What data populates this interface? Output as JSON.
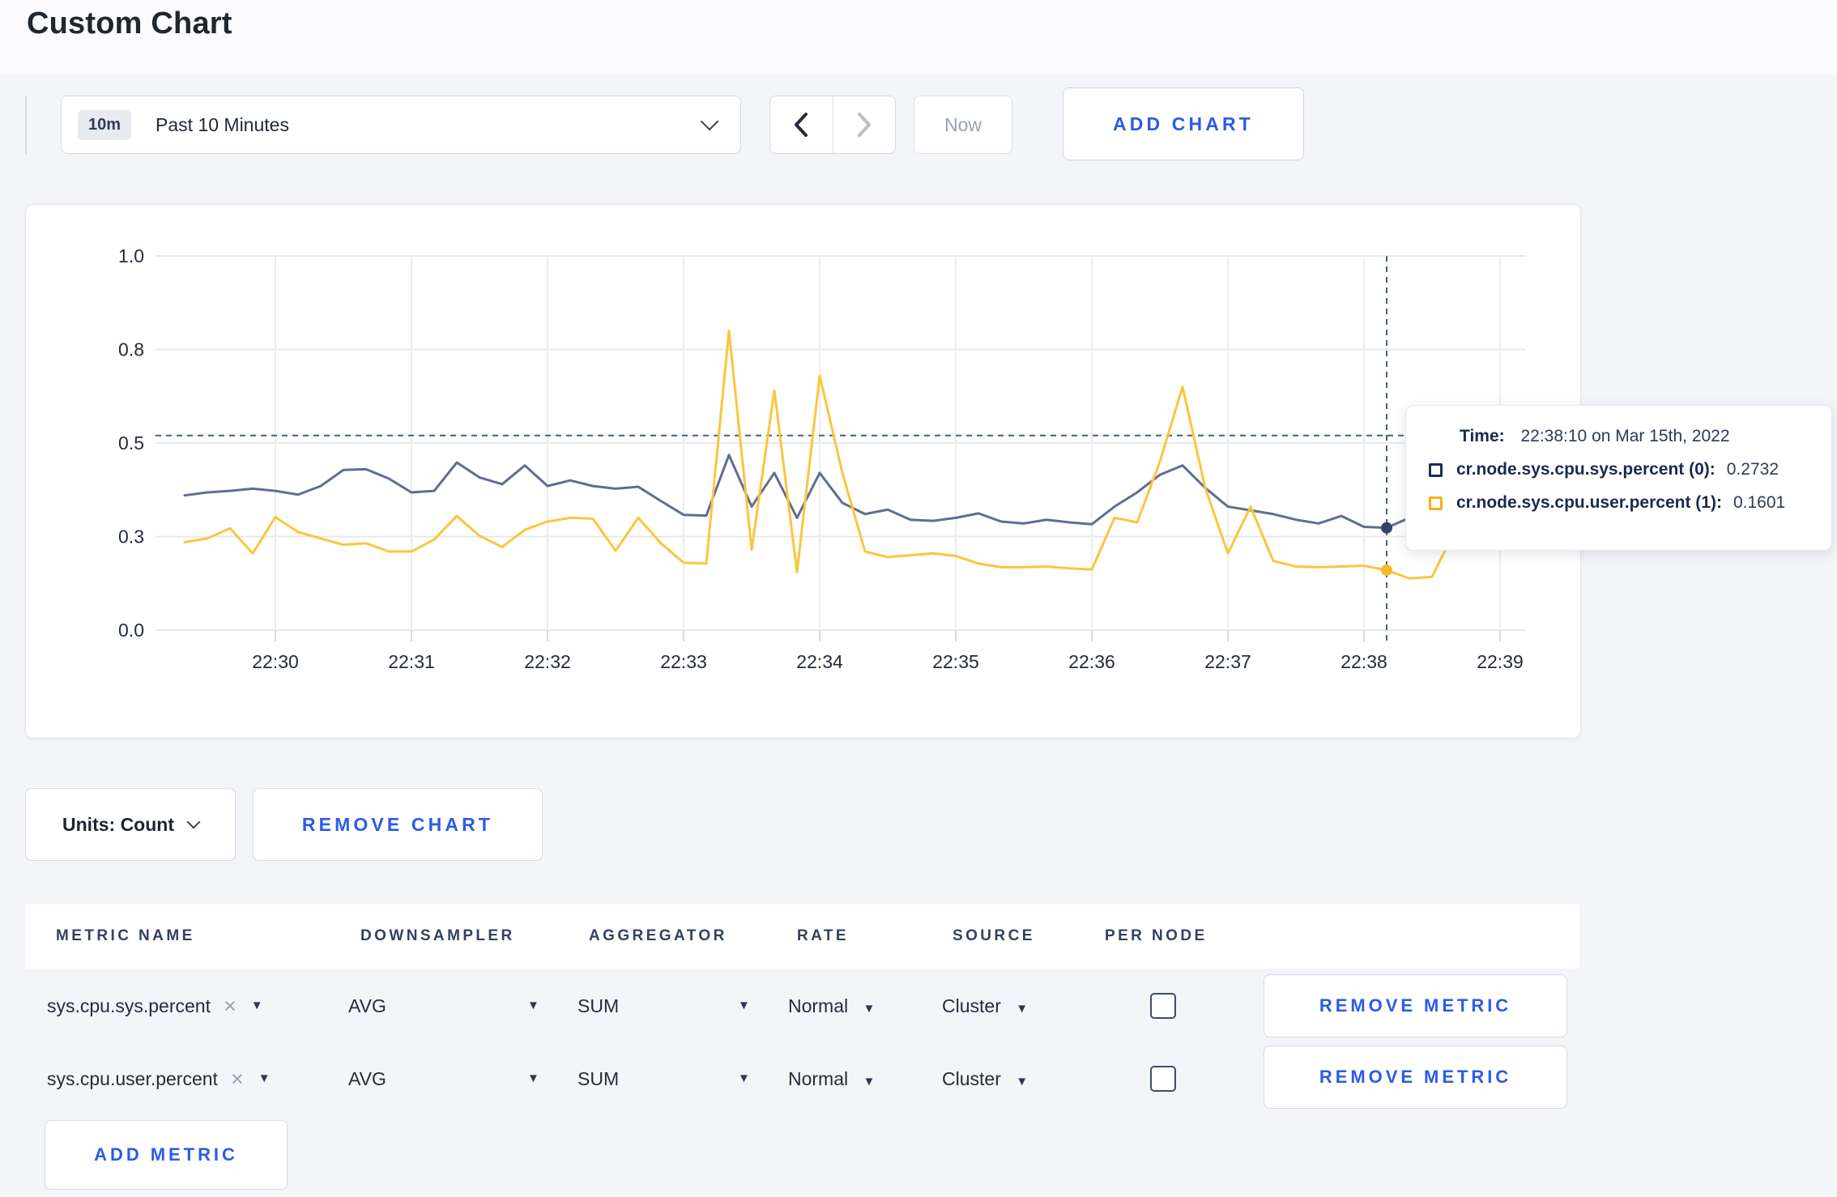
{
  "page": {
    "title": "Custom Chart"
  },
  "icons": {
    "caret_down": "▼",
    "close": "×"
  },
  "toolbar": {
    "range_badge": "10m",
    "range_label": "Past 10 Minutes",
    "now_label": "Now",
    "add_chart_label": "ADD CHART"
  },
  "chart_data": {
    "type": "line",
    "title": "",
    "xlabel": "",
    "ylabel": "",
    "ylim": [
      0,
      1.0
    ],
    "grid": true,
    "x_axis": {
      "labels": [
        "22:30",
        "22:31",
        "22:32",
        "22:33",
        "22:34",
        "22:35",
        "22:36",
        "22:37",
        "22:38",
        "22:39"
      ]
    },
    "y_axis": {
      "ticks": [
        {
          "label": "1.0",
          "value": 1.0
        },
        {
          "label": "0.8",
          "value": 0.75
        },
        {
          "label": "0.5",
          "value": 0.5
        },
        {
          "label": "0.3",
          "value": 0.25
        },
        {
          "label": "0.0",
          "value": 0.0
        }
      ]
    },
    "x_seconds": [
      -40,
      -30,
      -20,
      -10,
      0,
      10,
      20,
      30,
      40,
      50,
      60,
      70,
      80,
      90,
      100,
      110,
      120,
      130,
      140,
      150,
      160,
      170,
      180,
      190,
      200,
      210,
      220,
      230,
      240,
      250,
      260,
      270,
      280,
      290,
      300,
      310,
      320,
      330,
      340,
      350,
      360,
      370,
      380,
      390,
      400,
      410,
      420,
      430,
      440,
      450,
      460,
      470,
      480,
      490,
      500,
      510,
      520,
      530,
      540,
      550
    ],
    "series": [
      {
        "name": "cr.node.sys.cpu.sys.percent",
        "color": "#5f6e90",
        "dot_color": "#32436b",
        "values": [
          0.36,
          0.368,
          0.372,
          0.378,
          0.372,
          0.362,
          0.385,
          0.428,
          0.43,
          0.405,
          0.368,
          0.372,
          0.448,
          0.408,
          0.39,
          0.44,
          0.385,
          0.4,
          0.385,
          0.378,
          0.383,
          0.345,
          0.308,
          0.306,
          0.468,
          0.33,
          0.42,
          0.3,
          0.42,
          0.34,
          0.31,
          0.322,
          0.295,
          0.292,
          0.3,
          0.312,
          0.29,
          0.285,
          0.295,
          0.288,
          0.283,
          0.33,
          0.368,
          0.415,
          0.44,
          0.38,
          0.33,
          0.32,
          0.31,
          0.295,
          0.285,
          0.305,
          0.276,
          0.2732,
          0.3,
          0.295,
          0.298,
          0.3,
          0.298,
          0.3
        ]
      },
      {
        "name": "cr.node.sys.cpu.user.percent",
        "color": "#fbc63d",
        "dot_color": "#f5b92b",
        "values": [
          0.235,
          0.245,
          0.272,
          0.205,
          0.302,
          0.262,
          0.245,
          0.228,
          0.232,
          0.21,
          0.21,
          0.242,
          0.305,
          0.252,
          0.222,
          0.268,
          0.29,
          0.3,
          0.298,
          0.212,
          0.3,
          0.232,
          0.18,
          0.178,
          0.8,
          0.215,
          0.64,
          0.155,
          0.68,
          0.42,
          0.21,
          0.195,
          0.2,
          0.205,
          0.198,
          0.178,
          0.168,
          0.168,
          0.17,
          0.165,
          0.162,
          0.3,
          0.288,
          0.45,
          0.65,
          0.38,
          0.205,
          0.33,
          0.185,
          0.17,
          0.168,
          0.17,
          0.172,
          0.1601,
          0.138,
          0.142,
          0.265,
          0.28,
          0.235,
          0.252
        ]
      }
    ],
    "crosshair": {
      "x_seconds": 490,
      "y_value": 0.52,
      "color": "#44607c"
    },
    "highlight": [
      {
        "series": 0,
        "x_seconds": 490,
        "value": 0.2732
      },
      {
        "series": 1,
        "x_seconds": 490,
        "value": 0.1601
      }
    ]
  },
  "tooltip": {
    "time_label": "Time:",
    "time_value": "22:38:10 on Mar 15th, 2022",
    "rows": [
      {
        "label": "cr.node.sys.cpu.sys.percent (0):",
        "value": "0.2732",
        "color": "#1c2f55"
      },
      {
        "label": "cr.node.sys.cpu.user.percent (1):",
        "value": "0.1601",
        "color": "#f2b218"
      }
    ]
  },
  "chart_controls": {
    "units_label": "Units: Count",
    "remove_chart_label": "REMOVE CHART"
  },
  "metrics_table": {
    "headers": [
      "METRIC NAME",
      "DOWNSAMPLER",
      "AGGREGATOR",
      "RATE",
      "SOURCE",
      "PER NODE"
    ],
    "rows": [
      {
        "metric": "sys.cpu.sys.percent",
        "downsampler": "AVG",
        "aggregator": "SUM",
        "rate": "Normal",
        "source": "Cluster",
        "per_node_checked": false,
        "remove_label": "REMOVE METRIC"
      },
      {
        "metric": "sys.cpu.user.percent",
        "downsampler": "AVG",
        "aggregator": "SUM",
        "rate": "Normal",
        "source": "Cluster",
        "per_node_checked": false,
        "remove_label": "REMOVE METRIC"
      }
    ],
    "add_metric_label": "ADD METRIC"
  }
}
